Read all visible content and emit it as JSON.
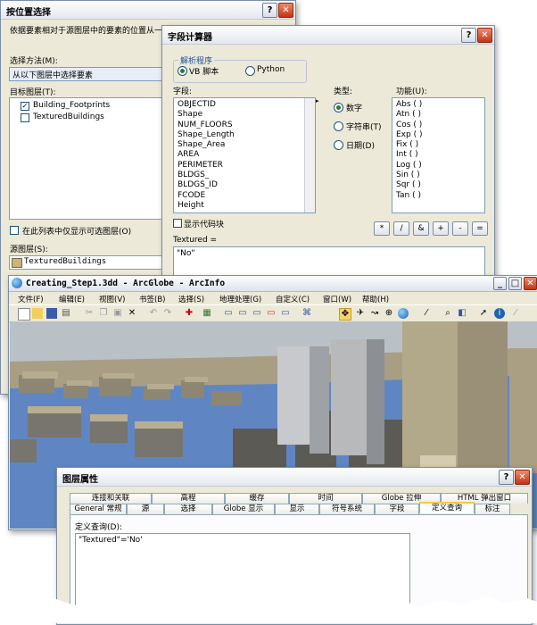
{
  "select_by_location": {
    "title": "按位置选择",
    "description": "依据要素相对于源图层中的要素的位置从一个或多个目标图层中选择要素。",
    "method_label": "选择方法(M):",
    "method_value": "从以下图层中选择要素",
    "target_label": "目标图层(T):",
    "layers": [
      {
        "name": "Building_Footprints",
        "checked": "✓"
      },
      {
        "name": "TexturedBuildings",
        "checked": ""
      }
    ],
    "only_selectable_label": "在此列表中仅显示可选图层(O)",
    "source_label": "源图层(S):",
    "source_value": "TexturedBuildings",
    "help": "?",
    "close": "✕"
  },
  "field_calculator": {
    "title": "字段计算器",
    "parser_label": "解析程序",
    "vb_label": "VB 脚本",
    "python_label": "Python",
    "fields_label": "字段:",
    "fields": [
      "OBJECTID",
      "Shape",
      "NUM_FLOORS",
      "Shape_Length",
      "Shape_Area",
      "AREA",
      "PERIMETER",
      "BLDGS_",
      "BLDGS_ID",
      "FCODE",
      "Height"
    ],
    "type_label": "类型:",
    "types": [
      "数字",
      "字符串(T)",
      "日期(D)"
    ],
    "functions_label": "功能(U):",
    "functions": [
      "Abs ( )",
      "Atn ( )",
      "Cos ( )",
      "Exp ( )",
      "Fix ( )",
      "Int ( )",
      "Log ( )",
      "Sin ( )",
      "Sqr ( )",
      "Tan ( )"
    ],
    "show_codeblock_label": "显示代码块",
    "operators": [
      "*",
      "/",
      "&",
      "+",
      "-",
      "="
    ],
    "expression_label": "Textured =",
    "expression_value": "\"No\"",
    "help": "?",
    "close": "✕"
  },
  "arcglobe": {
    "title": "Creating_Step1.3dd - ArcGlobe - ArcInfo",
    "menu": [
      "文件(F)",
      "编辑(E)",
      "视图(V)",
      "书签(B)",
      "选择(S)",
      "地理处理(G)",
      "自定义(C)",
      "窗口(W)",
      "帮助(H)"
    ],
    "min": "_",
    "max": "□",
    "close": "✕"
  },
  "layer_properties": {
    "title": "图层属性",
    "tabs_row1": [
      "连接和关联",
      "高程",
      "缓存",
      "时间",
      "Globe 拉伸",
      "HTML 弹出窗口"
    ],
    "tabs_row2": [
      "General 常规",
      "源",
      "选择",
      "Globe 显示",
      "显示",
      "符号系统",
      "字段",
      "定义查询",
      "标注"
    ],
    "query_label": "定义查询(D):",
    "query_value": "\"Textured\"='No'",
    "help": "?",
    "close": "✕"
  },
  "colors": {
    "window_bg": "#ece9d8",
    "water": "#5f86c2",
    "selected_tab_accent": "#ffc73c"
  }
}
